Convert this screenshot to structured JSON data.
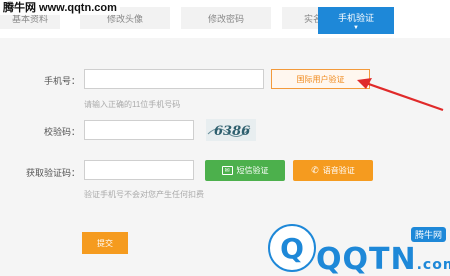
{
  "watermark": "腾牛网 www.qqtn.com",
  "tabs": [
    {
      "label": "基本资料"
    },
    {
      "label": "修改头像"
    },
    {
      "label": "修改密码"
    },
    {
      "label": "实名认证"
    },
    {
      "label": "手机验证"
    }
  ],
  "active_tab_caret": "▼",
  "form": {
    "phone_label": "手机号：",
    "phone_value": "",
    "phone_hint": "请输入正确的11位手机号码",
    "intl_button": "国际用户验证",
    "code_label": "校验码：",
    "code_value": "",
    "captcha_text": "6386",
    "sms_label": "获取验证码：",
    "sms_value": "",
    "sms_button": "短信验证",
    "voice_button": "语音验证",
    "sms_hint": "验证手机号不会对您产生任何扣费",
    "submit": "提交"
  },
  "brand": {
    "name": "QQTN",
    "domain_suffix": ".com",
    "badge": "腾牛网",
    "logo_letter": "Q"
  },
  "colors": {
    "accent_blue": "#1e88d8",
    "orange": "#f59b1f",
    "green": "#4cb04c",
    "arrow_red": "#e02a2a"
  }
}
